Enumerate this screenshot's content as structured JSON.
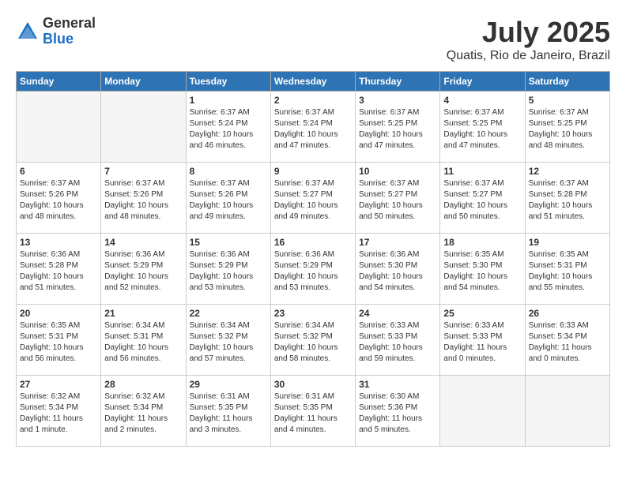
{
  "logo": {
    "general": "General",
    "blue": "Blue"
  },
  "title": {
    "month": "July 2025",
    "location": "Quatis, Rio de Janeiro, Brazil"
  },
  "calendar": {
    "headers": [
      "Sunday",
      "Monday",
      "Tuesday",
      "Wednesday",
      "Thursday",
      "Friday",
      "Saturday"
    ],
    "weeks": [
      [
        {
          "day": "",
          "empty": true
        },
        {
          "day": "",
          "empty": true
        },
        {
          "day": "1",
          "sunrise": "Sunrise: 6:37 AM",
          "sunset": "Sunset: 5:24 PM",
          "daylight": "Daylight: 10 hours and 46 minutes."
        },
        {
          "day": "2",
          "sunrise": "Sunrise: 6:37 AM",
          "sunset": "Sunset: 5:24 PM",
          "daylight": "Daylight: 10 hours and 47 minutes."
        },
        {
          "day": "3",
          "sunrise": "Sunrise: 6:37 AM",
          "sunset": "Sunset: 5:25 PM",
          "daylight": "Daylight: 10 hours and 47 minutes."
        },
        {
          "day": "4",
          "sunrise": "Sunrise: 6:37 AM",
          "sunset": "Sunset: 5:25 PM",
          "daylight": "Daylight: 10 hours and 47 minutes."
        },
        {
          "day": "5",
          "sunrise": "Sunrise: 6:37 AM",
          "sunset": "Sunset: 5:25 PM",
          "daylight": "Daylight: 10 hours and 48 minutes."
        }
      ],
      [
        {
          "day": "6",
          "sunrise": "Sunrise: 6:37 AM",
          "sunset": "Sunset: 5:26 PM",
          "daylight": "Daylight: 10 hours and 48 minutes."
        },
        {
          "day": "7",
          "sunrise": "Sunrise: 6:37 AM",
          "sunset": "Sunset: 5:26 PM",
          "daylight": "Daylight: 10 hours and 48 minutes."
        },
        {
          "day": "8",
          "sunrise": "Sunrise: 6:37 AM",
          "sunset": "Sunset: 5:26 PM",
          "daylight": "Daylight: 10 hours and 49 minutes."
        },
        {
          "day": "9",
          "sunrise": "Sunrise: 6:37 AM",
          "sunset": "Sunset: 5:27 PM",
          "daylight": "Daylight: 10 hours and 49 minutes."
        },
        {
          "day": "10",
          "sunrise": "Sunrise: 6:37 AM",
          "sunset": "Sunset: 5:27 PM",
          "daylight": "Daylight: 10 hours and 50 minutes."
        },
        {
          "day": "11",
          "sunrise": "Sunrise: 6:37 AM",
          "sunset": "Sunset: 5:27 PM",
          "daylight": "Daylight: 10 hours and 50 minutes."
        },
        {
          "day": "12",
          "sunrise": "Sunrise: 6:37 AM",
          "sunset": "Sunset: 5:28 PM",
          "daylight": "Daylight: 10 hours and 51 minutes."
        }
      ],
      [
        {
          "day": "13",
          "sunrise": "Sunrise: 6:36 AM",
          "sunset": "Sunset: 5:28 PM",
          "daylight": "Daylight: 10 hours and 51 minutes."
        },
        {
          "day": "14",
          "sunrise": "Sunrise: 6:36 AM",
          "sunset": "Sunset: 5:29 PM",
          "daylight": "Daylight: 10 hours and 52 minutes."
        },
        {
          "day": "15",
          "sunrise": "Sunrise: 6:36 AM",
          "sunset": "Sunset: 5:29 PM",
          "daylight": "Daylight: 10 hours and 53 minutes."
        },
        {
          "day": "16",
          "sunrise": "Sunrise: 6:36 AM",
          "sunset": "Sunset: 5:29 PM",
          "daylight": "Daylight: 10 hours and 53 minutes."
        },
        {
          "day": "17",
          "sunrise": "Sunrise: 6:36 AM",
          "sunset": "Sunset: 5:30 PM",
          "daylight": "Daylight: 10 hours and 54 minutes."
        },
        {
          "day": "18",
          "sunrise": "Sunrise: 6:35 AM",
          "sunset": "Sunset: 5:30 PM",
          "daylight": "Daylight: 10 hours and 54 minutes."
        },
        {
          "day": "19",
          "sunrise": "Sunrise: 6:35 AM",
          "sunset": "Sunset: 5:31 PM",
          "daylight": "Daylight: 10 hours and 55 minutes."
        }
      ],
      [
        {
          "day": "20",
          "sunrise": "Sunrise: 6:35 AM",
          "sunset": "Sunset: 5:31 PM",
          "daylight": "Daylight: 10 hours and 56 minutes."
        },
        {
          "day": "21",
          "sunrise": "Sunrise: 6:34 AM",
          "sunset": "Sunset: 5:31 PM",
          "daylight": "Daylight: 10 hours and 56 minutes."
        },
        {
          "day": "22",
          "sunrise": "Sunrise: 6:34 AM",
          "sunset": "Sunset: 5:32 PM",
          "daylight": "Daylight: 10 hours and 57 minutes."
        },
        {
          "day": "23",
          "sunrise": "Sunrise: 6:34 AM",
          "sunset": "Sunset: 5:32 PM",
          "daylight": "Daylight: 10 hours and 58 minutes."
        },
        {
          "day": "24",
          "sunrise": "Sunrise: 6:33 AM",
          "sunset": "Sunset: 5:33 PM",
          "daylight": "Daylight: 10 hours and 59 minutes."
        },
        {
          "day": "25",
          "sunrise": "Sunrise: 6:33 AM",
          "sunset": "Sunset: 5:33 PM",
          "daylight": "Daylight: 11 hours and 0 minutes."
        },
        {
          "day": "26",
          "sunrise": "Sunrise: 6:33 AM",
          "sunset": "Sunset: 5:34 PM",
          "daylight": "Daylight: 11 hours and 0 minutes."
        }
      ],
      [
        {
          "day": "27",
          "sunrise": "Sunrise: 6:32 AM",
          "sunset": "Sunset: 5:34 PM",
          "daylight": "Daylight: 11 hours and 1 minute."
        },
        {
          "day": "28",
          "sunrise": "Sunrise: 6:32 AM",
          "sunset": "Sunset: 5:34 PM",
          "daylight": "Daylight: 11 hours and 2 minutes."
        },
        {
          "day": "29",
          "sunrise": "Sunrise: 6:31 AM",
          "sunset": "Sunset: 5:35 PM",
          "daylight": "Daylight: 11 hours and 3 minutes."
        },
        {
          "day": "30",
          "sunrise": "Sunrise: 6:31 AM",
          "sunset": "Sunset: 5:35 PM",
          "daylight": "Daylight: 11 hours and 4 minutes."
        },
        {
          "day": "31",
          "sunrise": "Sunrise: 6:30 AM",
          "sunset": "Sunset: 5:36 PM",
          "daylight": "Daylight: 11 hours and 5 minutes."
        },
        {
          "day": "",
          "empty": true
        },
        {
          "day": "",
          "empty": true
        }
      ]
    ]
  }
}
